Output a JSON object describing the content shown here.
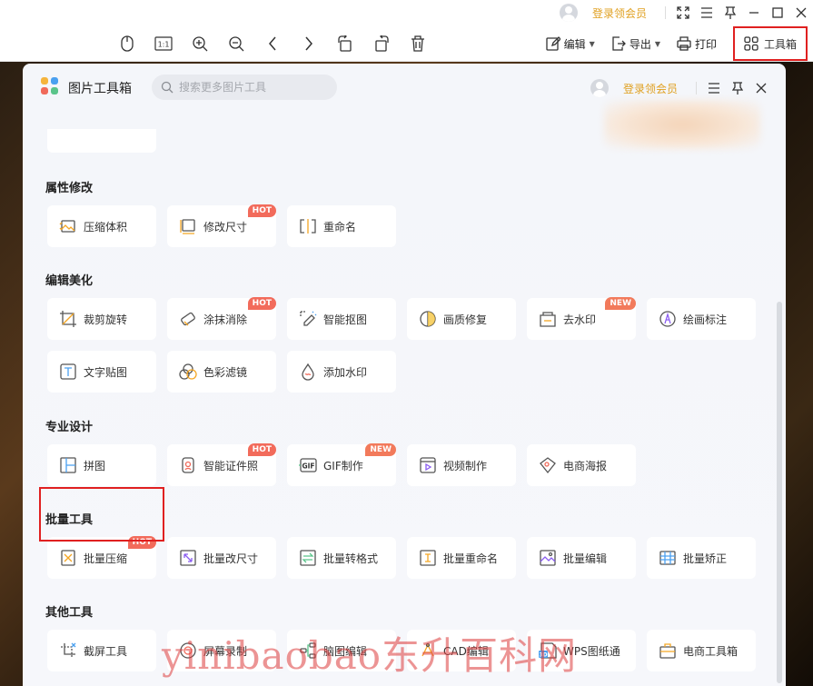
{
  "titlebar": {
    "vip_label": "登录领会员"
  },
  "toolbar": {
    "edit_label": "编辑",
    "export_label": "导出",
    "print_label": "打印",
    "toolbox_label": "工具箱"
  },
  "panel": {
    "title": "图片工具箱",
    "search_placeholder": "搜索更多图片工具",
    "vip_label": "登录领会员"
  },
  "sections": [
    {
      "title": "属性修改",
      "items": [
        {
          "label": "压缩体积",
          "icon": "compress-image-icon",
          "badge": ""
        },
        {
          "label": "修改尺寸",
          "icon": "resize-icon",
          "badge": "HOT"
        },
        {
          "label": "重命名",
          "icon": "rename-icon",
          "badge": ""
        }
      ]
    },
    {
      "title": "编辑美化",
      "items": [
        {
          "label": "裁剪旋转",
          "icon": "crop-icon",
          "badge": ""
        },
        {
          "label": "涂抹消除",
          "icon": "eraser-icon",
          "badge": "HOT"
        },
        {
          "label": "智能抠图",
          "icon": "smart-cutout-icon",
          "badge": ""
        },
        {
          "label": "画质修复",
          "icon": "quality-repair-icon",
          "badge": ""
        },
        {
          "label": "去水印",
          "icon": "remove-watermark-icon",
          "badge": "NEW"
        },
        {
          "label": "绘画标注",
          "icon": "draw-annotate-icon",
          "badge": ""
        },
        {
          "label": "文字贴图",
          "icon": "text-sticker-icon",
          "badge": ""
        },
        {
          "label": "色彩滤镜",
          "icon": "color-filter-icon",
          "badge": ""
        },
        {
          "label": "添加水印",
          "icon": "add-watermark-icon",
          "badge": ""
        }
      ]
    },
    {
      "title": "专业设计",
      "items": [
        {
          "label": "拼图",
          "icon": "collage-icon",
          "badge": ""
        },
        {
          "label": "智能证件照",
          "icon": "id-photo-icon",
          "badge": "HOT"
        },
        {
          "label": "GIF制作",
          "icon": "gif-icon",
          "badge": "NEW"
        },
        {
          "label": "视频制作",
          "icon": "video-make-icon",
          "badge": ""
        },
        {
          "label": "电商海报",
          "icon": "ecommerce-poster-icon",
          "badge": ""
        }
      ]
    },
    {
      "title": "批量工具",
      "items": [
        {
          "label": "批量压缩",
          "icon": "batch-compress-icon",
          "badge": "HOT"
        },
        {
          "label": "批量改尺寸",
          "icon": "batch-resize-icon",
          "badge": ""
        },
        {
          "label": "批量转格式",
          "icon": "batch-convert-icon",
          "badge": ""
        },
        {
          "label": "批量重命名",
          "icon": "batch-rename-icon",
          "badge": ""
        },
        {
          "label": "批量编辑",
          "icon": "batch-edit-icon",
          "badge": ""
        },
        {
          "label": "批量矫正",
          "icon": "batch-correct-icon",
          "badge": ""
        }
      ]
    },
    {
      "title": "其他工具",
      "items": [
        {
          "label": "截屏工具",
          "icon": "screenshot-icon",
          "badge": ""
        },
        {
          "label": "屏幕录制",
          "icon": "screen-record-icon",
          "badge": ""
        },
        {
          "label": "脑图编辑",
          "icon": "mindmap-icon",
          "badge": ""
        },
        {
          "label": "CAD编辑",
          "icon": "cad-icon",
          "badge": ""
        },
        {
          "label": "WPS图纸通",
          "icon": "wps-drawing-icon",
          "badge": ""
        },
        {
          "label": "电商工具箱",
          "icon": "ecommerce-toolbox-icon",
          "badge": ""
        }
      ]
    }
  ],
  "watermark": "yinibaobao东升百科网"
}
